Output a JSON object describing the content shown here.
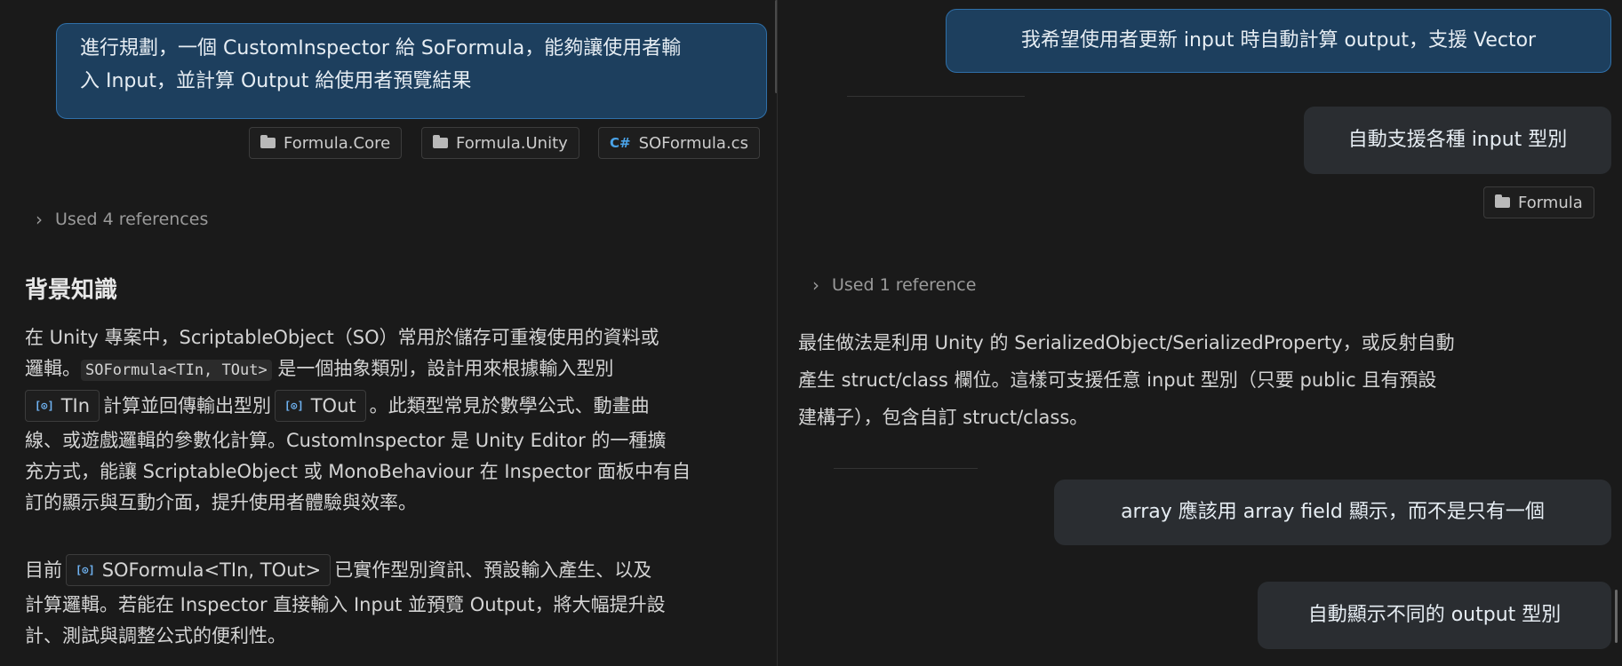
{
  "left": {
    "request_bubble": {
      "line1": "進行規劃，一個 CustomInspector 給 SoFormula，能夠讓使用者輸",
      "line2": "入 Input，並計算 Output 給使用者預覽結果"
    },
    "attachments": [
      {
        "label": "Formula.Core",
        "icon": "folder-icon"
      },
      {
        "label": "Formula.Unity",
        "icon": "folder-icon"
      },
      {
        "label": "SOFormula.cs",
        "icon": "csharp-file-icon",
        "glyph": "C#"
      }
    ],
    "references": "Used 4 references",
    "heading": "背景知識",
    "paragraph1": {
      "t1": "在 Unity 專案中，ScriptableObject（SO）常用於儲存可重複使用的資料或",
      "t2": "邏輯。",
      "code1": "SOFormula<TIn, TOut>",
      "t3": " 是一個抽象類別，設計用來根據輸入型別",
      "sym_tin": "TIn",
      "t4": "計算並回傳輸出型別",
      "sym_tout": "TOut",
      "t5": "。此類型常見於數學公式、動畫曲",
      "t6": "線、或遊戲邏輯的參數化計算。CustomInspector 是 Unity Editor 的一種擴",
      "t7": "充方式，能讓 ScriptableObject 或 MonoBehaviour 在 Inspector 面板中有自",
      "t8": "訂的顯示與互動介面，提升使用者體驗與效率。"
    },
    "paragraph2": {
      "t1": "目前",
      "sym_soformula": "SOFormula<TIn, TOut>",
      "t2": "已實作型別資訊、預設輸入產生、以及",
      "t3": "計算邏輯。若能在 Inspector 直接輸入 Input 並預覽 Output，將大幅提升設",
      "t4": "計、測試與調整公式的便利性。"
    }
  },
  "right": {
    "bubble1": "我希望使用者更新 input 時自動計算 output，支援 Vector",
    "bubble2": "自動支援各種 input 型別",
    "attachment": "Formula",
    "references": "Used 1 reference",
    "answer": {
      "line1": "最佳做法是利用 Unity 的 SerializedObject/SerializedProperty，或反射自動",
      "line2": "產生 struct/class 欄位。這樣可支援任意 input 型別（只要 public 且有預設",
      "line3": "建構子），包含自訂 struct/class。"
    },
    "bubble3": "array 應該用 array field 顯示，而不是只有一個",
    "bubble4": "自動顯示不同的 output 型別"
  },
  "colors": {
    "background": "#1a1a1a",
    "user_bubble_blue": "#1d3f5e",
    "user_bubble_border": "#2f6fa8",
    "user_bubble_dark": "#2a2d31",
    "accent": "#4aa3e8"
  }
}
